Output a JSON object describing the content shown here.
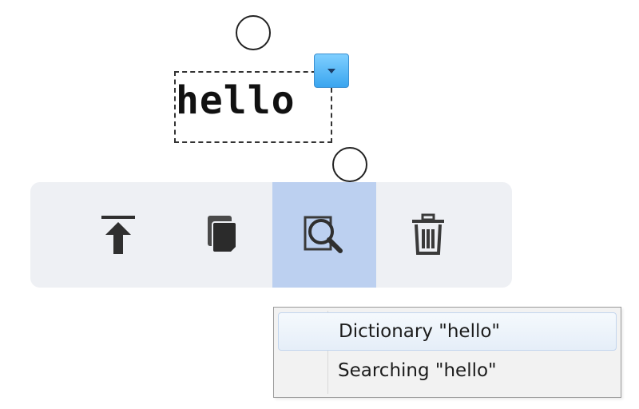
{
  "selection": {
    "text": "hello"
  },
  "icons": {
    "selection_start_handle": "circle-handle",
    "selection_end_handle": "circle-handle",
    "dropdown": "chevron-down-icon",
    "move_to_top": "arrow-to-top-icon",
    "copy": "copy-icon",
    "search": "magnifier-icon",
    "delete": "trash-icon"
  },
  "toolbar": {
    "highlighted_tool": "search"
  },
  "colors": {
    "dropdown_accent": "#3aa5ef",
    "toolbar_background": "#eef0f4",
    "active_tool_background": "#bcd0f0",
    "menu_hover_border": "#c3d6ee"
  },
  "context_menu": {
    "items": [
      {
        "label": "Dictionary \"hello\""
      },
      {
        "label": "Searching \"hello\""
      }
    ]
  }
}
